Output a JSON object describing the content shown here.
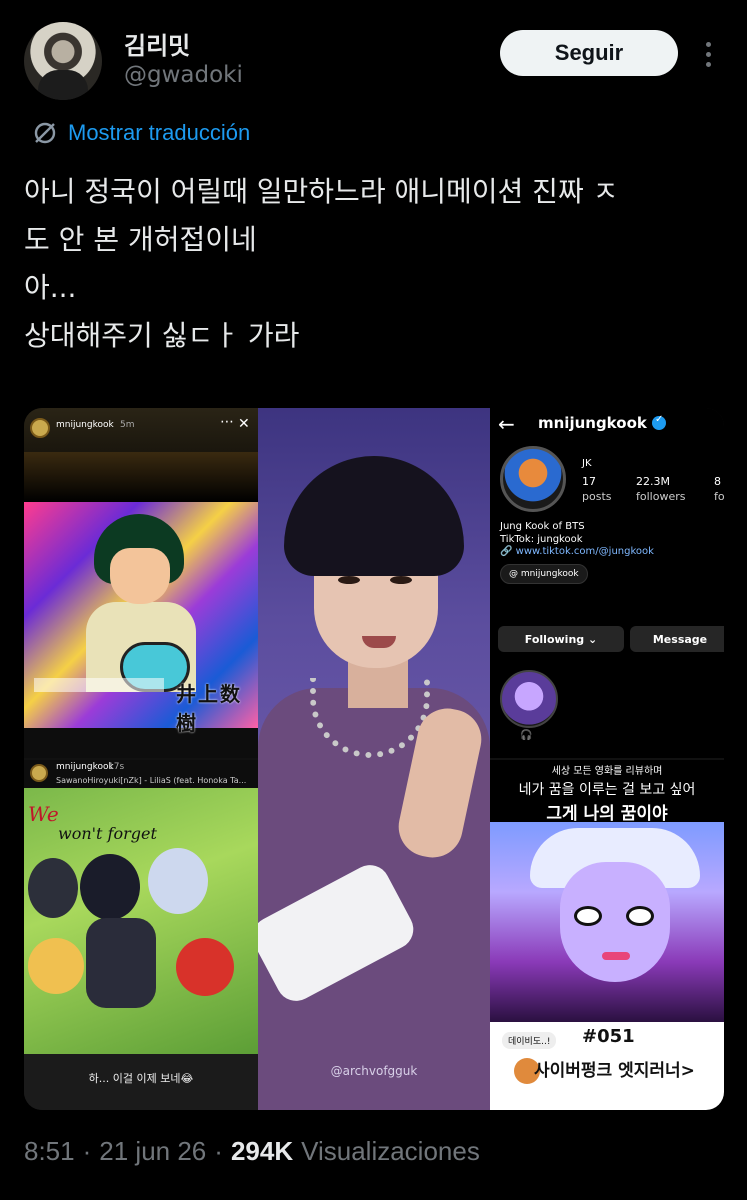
{
  "author": {
    "name": "김리밋",
    "handle": "@gwadoki"
  },
  "follow_label": "Seguir",
  "translate": {
    "label": "Mostrar traducción",
    "icon": "translate-icon"
  },
  "tweet_lines": [
    "아니 정국이 어릴때 일만하느라 애니메이션 진짜 ㅈ",
    "도 안 본 개허접이네",
    "아...",
    "상대해주기 싫ㄷㅏ 가라"
  ],
  "media": {
    "story1": {
      "account": "mnijungkook",
      "time": "5m",
      "overlay_text": "井上数樹"
    },
    "story2": {
      "account": "mnijungkook",
      "time": "17s",
      "song": "SawanoHiroyuki[nZk] - LiliaS (feat. Honoka Ta...",
      "script_line1": "We",
      "script_line2": "won't forget",
      "caption": "하... 이걸 이제 보네😂"
    },
    "center": {
      "watermark": "@archvofgguk"
    },
    "profile": {
      "username": "mnijungkook",
      "display": "JK",
      "posts_count": "17",
      "posts_label": "posts",
      "followers_count": "22.3M",
      "followers_label": "followers",
      "following_count": "8",
      "following_label": "fo",
      "bio_line1": "Jung Kook of BTS",
      "bio_line2": "TikTok: jungkook",
      "link": "www.tiktok.com/@jungkook",
      "threads_handle": "mnijungkook",
      "following_button": "Following ⌄",
      "message_button": "Message"
    },
    "review": {
      "small_line": "세상 모든 영화를 리뷰하며",
      "mid_line": "네가 꿈을 이루는 걸 보고 싶어",
      "big_line": "그게 나의 꿈이야",
      "pill": "데이비도..!",
      "number": "#051",
      "title": "사이버펑크 엣지러너>"
    }
  },
  "meta": {
    "time": "8:51",
    "date": "21 jun 26",
    "views_count": "294K",
    "views_label": "Visualizaciones"
  },
  "colors": {
    "background": "#000000",
    "link": "#1d9bf0",
    "muted": "#71767b",
    "text": "#e7e9ea"
  }
}
